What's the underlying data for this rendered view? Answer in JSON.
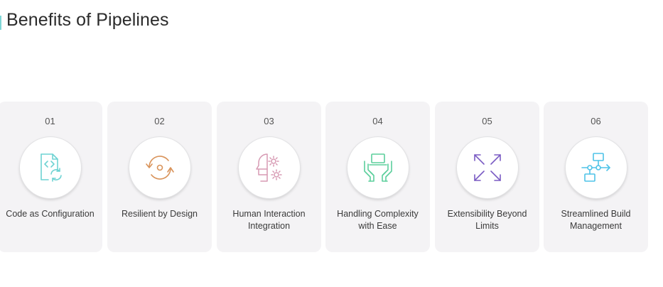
{
  "title": "Benefits of Pipelines",
  "colors": {
    "accent": "#7fd6d6",
    "card_bg": "#f4f3f5",
    "icon_teal": "#6fd3d3",
    "icon_orange": "#d9935a",
    "icon_pink": "#d79ab3",
    "icon_green": "#5ccf9c",
    "icon_purple": "#7b5cc4",
    "icon_cyan": "#4fc3e8"
  },
  "cards": [
    {
      "number": "01",
      "label": "Code as Configuration",
      "icon": "code-file-icon"
    },
    {
      "number": "02",
      "label": "Resilient by Design",
      "icon": "cycle-arrows-icon"
    },
    {
      "number": "03",
      "label": "Human Interaction Integration",
      "icon": "human-gear-icon"
    },
    {
      "number": "04",
      "label": "Handling Complexity with Ease",
      "icon": "hands-laptop-icon"
    },
    {
      "number": "05",
      "label": "Extensibility Beyond Limits",
      "icon": "expand-arrows-icon"
    },
    {
      "number": "06",
      "label": "Streamlined Build Management",
      "icon": "flowchart-icon"
    }
  ]
}
